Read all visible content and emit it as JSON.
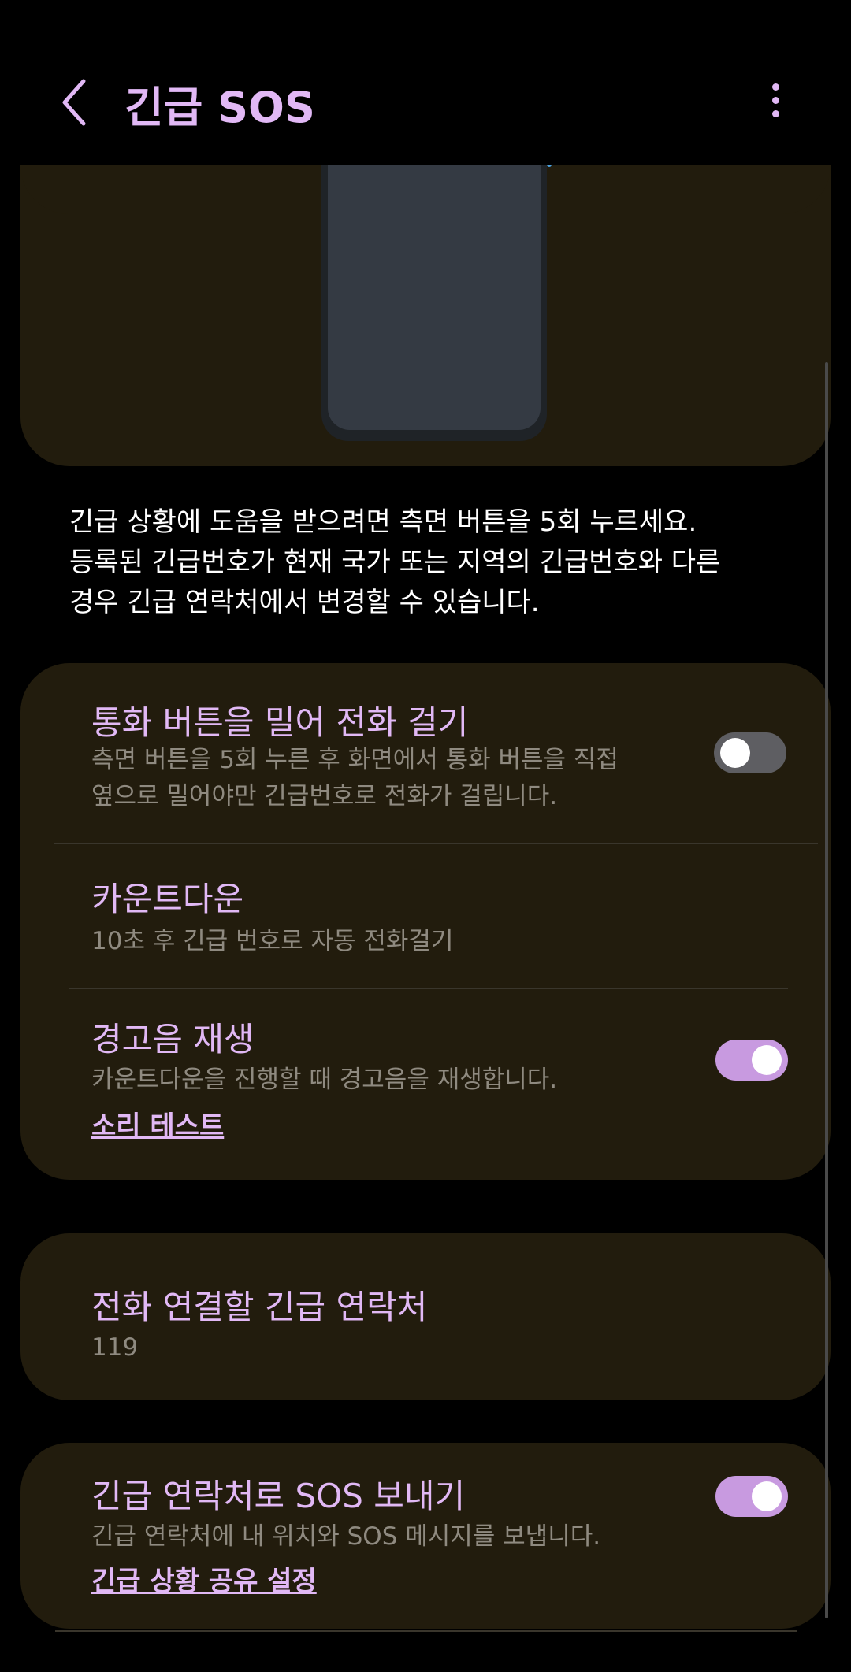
{
  "header": {
    "title": "긴급 SOS",
    "back_icon": "chevron-left-icon",
    "more_icon": "more-vertical-icon"
  },
  "description": {
    "lines": [
      "긴급 상황에 도움을 받으려면 측면 버튼을 5회 누르세요.",
      "등록된 긴급번호가 현재 국가 또는 지역의 긴급번호와 다른",
      "경우 긴급 연락처에서 변경할 수 있습니다."
    ]
  },
  "settings": {
    "swipe_call": {
      "title": "통화 버튼을 밀어 전화 걸기",
      "subtitle_lines": [
        "측면 버튼을 5회 누른 후 화면에서 통화 버튼을 직접",
        "옆으로 밀어야만 긴급번호로 전화가 걸립니다."
      ],
      "enabled": false
    },
    "countdown": {
      "title": "카운트다운",
      "subtitle": "10초 후 긴급 번호로 자동 전화걸기"
    },
    "alarm_sound": {
      "title": "경고음 재생",
      "subtitle": "카운트다운을 진행할 때 경고음을 재생합니다.",
      "link": "소리 테스트",
      "enabled": true
    },
    "emergency_contact": {
      "title": "전화 연결할 긴급 연락처",
      "value": "119"
    },
    "send_sos": {
      "title": "긴급 연락처로 SOS 보내기",
      "subtitle": "긴급 연락처에 내 위치와 SOS 메시지를 보냅니다.",
      "link": "긴급 상황 공유 설정",
      "enabled": true
    }
  },
  "colors": {
    "accent": "#e1b8f5",
    "card_bg": "#221c0d",
    "toggle_on": "#c89ae0",
    "toggle_off": "#5e5e62"
  }
}
